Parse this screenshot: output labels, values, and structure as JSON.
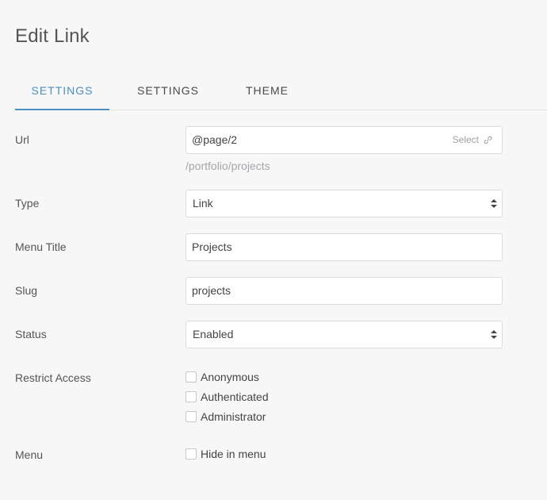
{
  "header": {
    "title": "Edit Link"
  },
  "tabs": [
    {
      "label": "SETTINGS",
      "active": true
    },
    {
      "label": "SETTINGS",
      "active": false
    },
    {
      "label": "THEME",
      "active": false
    }
  ],
  "form": {
    "url": {
      "label": "Url",
      "value": "@page/2",
      "select_label": "Select",
      "select_icon": "link-icon",
      "resolved_path": "/portfolio/projects"
    },
    "type": {
      "label": "Type",
      "value": "Link"
    },
    "menu_title": {
      "label": "Menu Title",
      "value": "Projects"
    },
    "slug": {
      "label": "Slug",
      "value": "projects"
    },
    "status": {
      "label": "Status",
      "value": "Enabled"
    },
    "restrict_access": {
      "label": "Restrict Access",
      "options": [
        {
          "label": "Anonymous",
          "checked": false
        },
        {
          "label": "Authenticated",
          "checked": false
        },
        {
          "label": "Administrator",
          "checked": false
        }
      ]
    },
    "menu": {
      "label": "Menu",
      "option": {
        "label": "Hide in menu",
        "checked": false
      }
    }
  },
  "colors": {
    "accent": "#4a90c4",
    "background": "#f7f7f8",
    "border": "#dcdcdf"
  }
}
